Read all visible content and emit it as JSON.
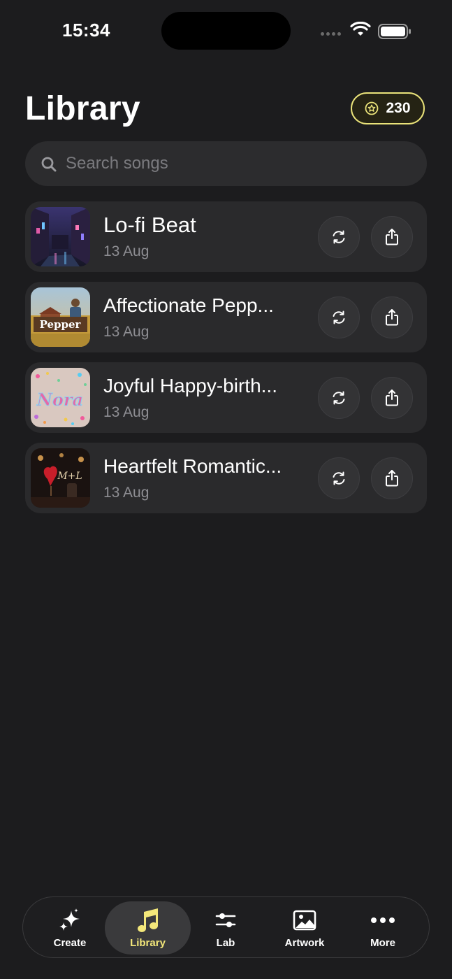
{
  "status_bar": {
    "time": "15:34"
  },
  "header": {
    "title": "Library",
    "credits": "230"
  },
  "search": {
    "placeholder": "Search songs"
  },
  "songs": [
    {
      "title": "Lo-fi Beat",
      "date": "13 Aug"
    },
    {
      "title": "Affectionate Pepp...",
      "date": "13 Aug",
      "artwork_text": "Pepper"
    },
    {
      "title": "Joyful Happy-birth...",
      "date": "13 Aug",
      "artwork_text": "Nora"
    },
    {
      "title": "Heartfelt Romantic...",
      "date": "13 Aug",
      "artwork_text": "M+L"
    }
  ],
  "tabs": [
    {
      "label": "Create",
      "icon": "sparkles-icon"
    },
    {
      "label": "Library",
      "icon": "music-note-icon",
      "active": true
    },
    {
      "label": "Lab",
      "icon": "sliders-icon"
    },
    {
      "label": "Artwork",
      "icon": "image-icon"
    },
    {
      "label": "More",
      "icon": "ellipsis-icon"
    }
  ],
  "colors": {
    "accent": "#f3e77a",
    "background": "#1c1c1e",
    "card": "#2a2a2c"
  }
}
